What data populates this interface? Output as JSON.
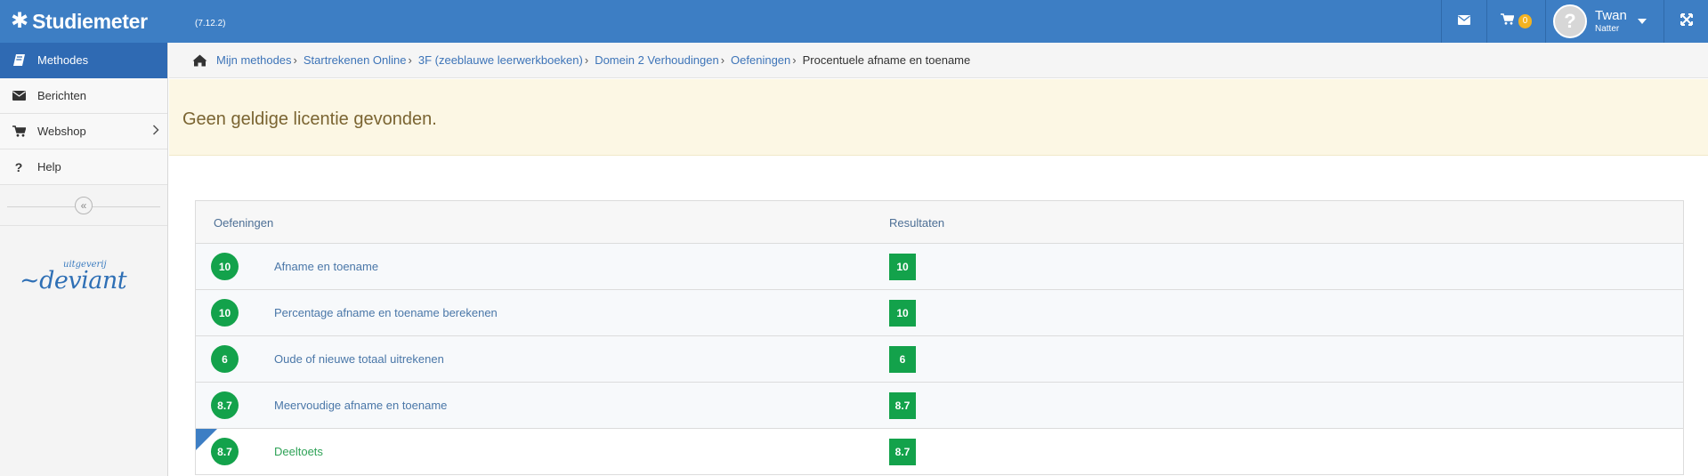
{
  "header": {
    "brand_star": "✱",
    "brand_name": "Studiemeter",
    "version": "(7.12.2)",
    "cart_count": "0",
    "user_first": "Twan",
    "user_last": "Natter",
    "avatar_glyph": "?",
    "icons": {
      "mail": "envelope-icon",
      "cart": "cart-icon",
      "expand": "fullscreen-icon"
    },
    "colors": {
      "bar": "#3d7ec4",
      "badge": "#f3b322"
    }
  },
  "sidebar": {
    "items": [
      {
        "label": "Methodes",
        "icon": "book-icon"
      },
      {
        "label": "Berichten",
        "icon": "envelope-icon"
      },
      {
        "label": "Webshop",
        "icon": "cart-icon"
      },
      {
        "label": "Help",
        "icon": "question-icon"
      }
    ],
    "collapse_glyph": "«",
    "logo_top": "uitgeverij",
    "logo_main": "~deviant"
  },
  "breadcrumb": {
    "links": [
      "Mijn methodes",
      "Startrekenen Online",
      "3F (zeeblauwe leerwerkboeken)",
      "Domein 2 Verhoudingen",
      "Oefeningen"
    ],
    "current": "Procentuele afname en toename"
  },
  "alert": {
    "text": "Geen geldige licentie gevonden."
  },
  "table": {
    "col_exercises": "Oefeningen",
    "col_results": "Resultaten",
    "rows": [
      {
        "score": "10",
        "name": "Afname en toename",
        "result": "10"
      },
      {
        "score": "10",
        "name": "Percentage afname en toename berekenen",
        "result": "10"
      },
      {
        "score": "6",
        "name": "Oude of nieuwe totaal uitrekenen",
        "result": "6"
      },
      {
        "score": "8.7",
        "name": "Meervoudige afname en toename",
        "result": "8.7"
      },
      {
        "score": "8.7",
        "name": "Deeltoets",
        "result": "8.7"
      }
    ],
    "colors": {
      "score_green": "#13a24b"
    }
  }
}
